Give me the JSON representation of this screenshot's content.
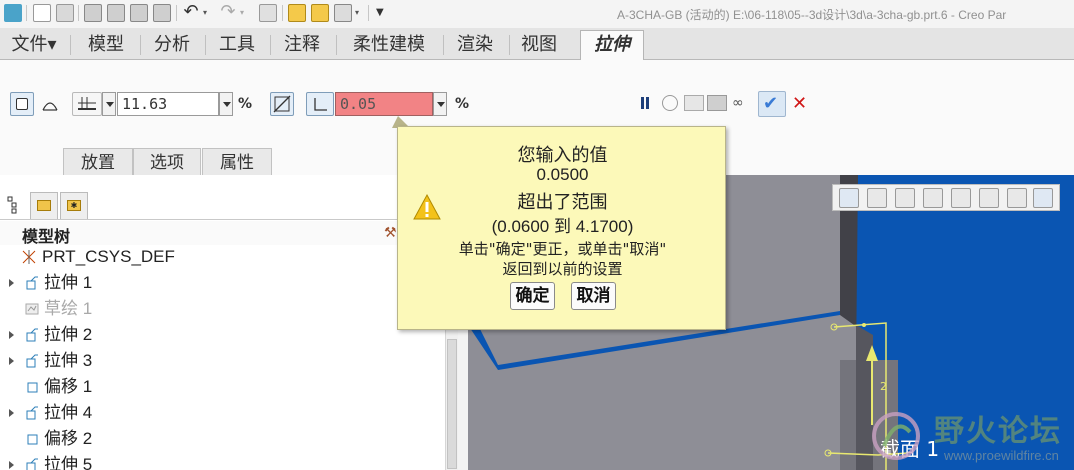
{
  "window": {
    "title": "A-3CHA-GB (活动的) E:\\06-118\\05--3d设计\\3d\\a-3cha-gb.prt.6 - Creo Par"
  },
  "ribbon": {
    "tabs": [
      {
        "label": "文件▾"
      },
      {
        "label": "模型"
      },
      {
        "label": "分析"
      },
      {
        "label": "工具"
      },
      {
        "label": "注释"
      },
      {
        "label": "柔性建模"
      },
      {
        "label": "渲染"
      },
      {
        "label": "视图"
      },
      {
        "label": "拉伸"
      }
    ]
  },
  "dashboard": {
    "depth_value": "11.63",
    "thickness_value": "0.05",
    "thickness_invalid_color": "#f08080",
    "subtabs": [
      {
        "label": "放置"
      },
      {
        "label": "选项"
      },
      {
        "label": "属性"
      }
    ]
  },
  "model_tree": {
    "header": "模型树",
    "items": [
      {
        "label": "PRT_CSYS_DEF",
        "expandable": false,
        "icon": "csys-icon",
        "dimmed": false
      },
      {
        "label": "拉伸 1",
        "expandable": true,
        "icon": "extrude-icon",
        "dimmed": false
      },
      {
        "label": "草绘 1",
        "expandable": false,
        "icon": "sketch-icon",
        "dimmed": true
      },
      {
        "label": "拉伸 2",
        "expandable": true,
        "icon": "extrude-icon",
        "dimmed": false
      },
      {
        "label": "拉伸 3",
        "expandable": true,
        "icon": "extrude-icon",
        "dimmed": false
      },
      {
        "label": "偏移 1",
        "expandable": false,
        "icon": "offset-icon",
        "dimmed": false
      },
      {
        "label": "拉伸 4",
        "expandable": true,
        "icon": "extrude-icon",
        "dimmed": false
      },
      {
        "label": "偏移 2",
        "expandable": false,
        "icon": "offset-icon",
        "dimmed": false
      },
      {
        "label": "拉伸 5",
        "expandable": true,
        "icon": "extrude-icon",
        "dimmed": false
      }
    ]
  },
  "tooltip": {
    "line1": "您输入的值",
    "line2": "0.0500",
    "line3": "超出了范围",
    "line4": "(0.0600 到 4.1700)",
    "line5": "单击\"确定\"更正，或单击\"取消\"",
    "line6": "返回到以前的设置",
    "ok_label": "确定",
    "cancel_label": "取消",
    "icon": "warning-icon"
  },
  "graphics": {
    "section_label": "截面 1",
    "dim_label": "2",
    "background_color": "#0a55b2"
  },
  "watermark": {
    "title": "野火论坛",
    "url": "www.proewildfire.cn"
  }
}
